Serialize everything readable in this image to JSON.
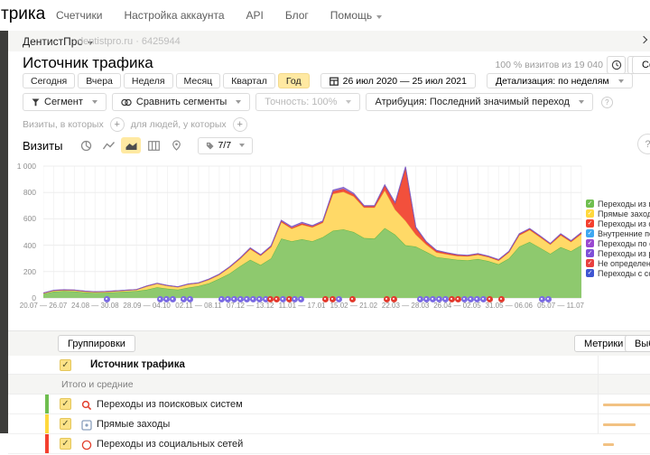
{
  "topnav": {
    "logo": "трика",
    "items": [
      "Счетчики",
      "Настройка аккаунта",
      "API",
      "Блог",
      "Помощь"
    ]
  },
  "counter_bar": {
    "counter_name": "ДентистПро",
    "counter_info": "dentistpro.ru · 6425944"
  },
  "header": {
    "title": "Источник трафика",
    "sample_note": "100 % визитов из 19 040",
    "save_button": "Сохранить"
  },
  "period_bar": {
    "presets": [
      "Сегодня",
      "Вчера",
      "Неделя",
      "Месяц",
      "Квартал",
      "Год"
    ],
    "selected_preset": "Год",
    "date_range": "26 июл 2020 — 25 июл 2021",
    "detalization": "Детализация: по неделям"
  },
  "segment_bar": {
    "segment": "Сегмент",
    "compare": "Сравнить сегменты",
    "accuracy": "Точность: 100%",
    "attribution": "Атрибуция: Последний значимый переход"
  },
  "filter_bar": {
    "visits_label": "Визиты, в которых",
    "people_label": "для людей, у которых"
  },
  "chart_controls": {
    "metric_label": "Визиты",
    "ratio_label": "7/7"
  },
  "chart_data": {
    "type": "area",
    "stacked": true,
    "title": "Визиты",
    "ylabel": "Визиты",
    "ylim": [
      0,
      1000
    ],
    "grid": true,
    "legend_position": "right",
    "y_ticks": [
      {
        "value": 0,
        "label": "0"
      },
      {
        "value": 200,
        "label": "200"
      },
      {
        "value": 400,
        "label": "400"
      },
      {
        "value": 600,
        "label": "600"
      },
      {
        "value": 800,
        "label": "800"
      },
      {
        "value": 1000,
        "label": "1 000"
      }
    ],
    "x_tick_labels": [
      {
        "week": 1,
        "label": "20.07 — 26.07"
      },
      {
        "week": 6,
        "label": "24.08 — 30.08"
      },
      {
        "week": 11,
        "label": "28.09 — 04.10"
      },
      {
        "week": 16,
        "label": "02.11 — 08.11"
      },
      {
        "week": 21,
        "label": "07.12 — 13.12"
      },
      {
        "week": 26,
        "label": "11.01 — 17.01"
      },
      {
        "week": 31,
        "label": "15.02 — 21.02"
      },
      {
        "week": 36,
        "label": "22.03 — 28.03"
      },
      {
        "week": 41,
        "label": "26.04 — 02.05"
      },
      {
        "week": 46,
        "label": "31.05 — 06.06"
      },
      {
        "week": 51,
        "label": "05.07 — 11.07"
      }
    ],
    "weeks": 53,
    "series": [
      {
        "name": "Переходы из поисковых систем",
        "color": "#8ec96e",
        "edge": "#63b643",
        "values": [
          30,
          48,
          52,
          50,
          42,
          38,
          40,
          44,
          48,
          52,
          62,
          80,
          70,
          62,
          78,
          90,
          110,
          145,
          185,
          240,
          290,
          250,
          300,
          450,
          430,
          445,
          430,
          460,
          510,
          520,
          500,
          455,
          450,
          530,
          480,
          400,
          390,
          350,
          310,
          300,
          290,
          285,
          295,
          280,
          255,
          300,
          390,
          425,
          380,
          335,
          385,
          355,
          400
        ]
      },
      {
        "name": "Прямые заходы",
        "color": "#ffd967",
        "edge": "#efc243",
        "values": [
          6,
          8,
          8,
          8,
          8,
          7,
          7,
          8,
          9,
          10,
          26,
          28,
          22,
          20,
          25,
          22,
          28,
          30,
          45,
          55,
          80,
          70,
          85,
          125,
          95,
          110,
          105,
          110,
          280,
          285,
          270,
          230,
          235,
          285,
          190,
          185,
          90,
          55,
          35,
          30,
          28,
          30,
          32,
          30,
          28,
          45,
          85,
          90,
          80,
          70,
          90,
          70,
          85
        ]
      },
      {
        "name": "Переходы из социальных сетей",
        "color": "#f2503c",
        "edge": "#de3a28",
        "values": [
          1,
          1,
          1,
          1,
          1,
          1,
          1,
          1,
          1,
          1,
          2,
          2,
          2,
          2,
          2,
          2,
          3,
          3,
          4,
          5,
          6,
          5,
          6,
          8,
          8,
          10,
          8,
          8,
          18,
          22,
          15,
          10,
          10,
          35,
          45,
          400,
          50,
          18,
          12,
          10,
          8,
          6,
          6,
          5,
          5,
          6,
          8,
          8,
          8,
          6,
          8,
          6,
          8
        ]
      },
      {
        "name": "Переходы по ссылкам на сайтах",
        "color": "#9d7fd8",
        "edge": "#8060c5",
        "values": [
          1,
          1,
          1,
          1,
          1,
          1,
          1,
          1,
          1,
          1,
          1,
          1,
          1,
          1,
          1,
          1,
          2,
          2,
          2,
          3,
          4,
          3,
          4,
          6,
          8,
          8,
          6,
          6,
          10,
          12,
          8,
          6,
          6,
          8,
          8,
          10,
          8,
          5,
          4,
          3,
          3,
          3,
          3,
          3,
          3,
          3,
          4,
          4,
          4,
          3,
          4,
          3,
          4
        ]
      }
    ],
    "annotations": [
      {
        "x": 70,
        "color": "v"
      },
      {
        "x": 129,
        "color": "v"
      },
      {
        "x": 136,
        "color": "v"
      },
      {
        "x": 143,
        "color": "v"
      },
      {
        "x": 155,
        "color": "v"
      },
      {
        "x": 162,
        "color": "v"
      },
      {
        "x": 197,
        "color": "v"
      },
      {
        "x": 204,
        "color": "v"
      },
      {
        "x": 211,
        "color": "v"
      },
      {
        "x": 218,
        "color": "v"
      },
      {
        "x": 225,
        "color": "v"
      },
      {
        "x": 232,
        "color": "v"
      },
      {
        "x": 239,
        "color": "v"
      },
      {
        "x": 246,
        "color": "v"
      },
      {
        "x": 251,
        "color": "r"
      },
      {
        "x": 258,
        "color": "r"
      },
      {
        "x": 265,
        "color": "v"
      },
      {
        "x": 272,
        "color": "r"
      },
      {
        "x": 278,
        "color": "v"
      },
      {
        "x": 285,
        "color": "v"
      },
      {
        "x": 312,
        "color": "r"
      },
      {
        "x": 320,
        "color": "r"
      },
      {
        "x": 327,
        "color": "v"
      },
      {
        "x": 342,
        "color": "r"
      },
      {
        "x": 380,
        "color": "r"
      },
      {
        "x": 388,
        "color": "r"
      },
      {
        "x": 417,
        "color": "v"
      },
      {
        "x": 424,
        "color": "v"
      },
      {
        "x": 431,
        "color": "v"
      },
      {
        "x": 438,
        "color": "v"
      },
      {
        "x": 445,
        "color": "v"
      },
      {
        "x": 452,
        "color": "r"
      },
      {
        "x": 459,
        "color": "r"
      },
      {
        "x": 466,
        "color": "v"
      },
      {
        "x": 473,
        "color": "v"
      },
      {
        "x": 480,
        "color": "v"
      },
      {
        "x": 487,
        "color": "v"
      },
      {
        "x": 494,
        "color": "r"
      },
      {
        "x": 507,
        "color": "r"
      },
      {
        "x": 552,
        "color": "v"
      },
      {
        "x": 559,
        "color": "v"
      }
    ],
    "annotation_colors": {
      "v": "#7b6ce2",
      "r": "#e23b2e"
    }
  },
  "legend": {
    "items": [
      {
        "label": "Переходы из поисковых систем",
        "color": "#6fbe4f"
      },
      {
        "label": "Прямые заходы",
        "color": "#ffd83c"
      },
      {
        "label": "Переходы из социальных сетей",
        "color": "#f4402f"
      },
      {
        "label": "Внутренние переходы",
        "color": "#3ea7f1"
      },
      {
        "label": "Переходы по ссылкам на сайтах",
        "color": "#9a48d0"
      },
      {
        "label": "Переходы из рекомендательных систем",
        "color": "#7e4fd8"
      },
      {
        "label": "Не определено",
        "color": "#e8403f"
      },
      {
        "label": "Переходы с сохранённых страниц",
        "color": "#3f55d2"
      }
    ]
  },
  "table": {
    "groupings_button": "Группировки",
    "metrics_button": "Метрики",
    "goal_button": "Выбрать цель",
    "dimension_header": "Источник трафика",
    "totals_label": "Итого и средние",
    "rows": [
      {
        "label": "Переходы из поисковых систем",
        "edge_color": "#6fbe4f",
        "icon": "search-icon",
        "bar_frac": 1.0
      },
      {
        "label": "Прямые заходы",
        "edge_color": "#ffd83c",
        "icon": "direct-icon",
        "bar_frac": 0.62
      },
      {
        "label": "Переходы из социальных сетей",
        "edge_color": "#f4402f",
        "icon": "social-icon",
        "bar_frac": 0.2
      }
    ]
  }
}
